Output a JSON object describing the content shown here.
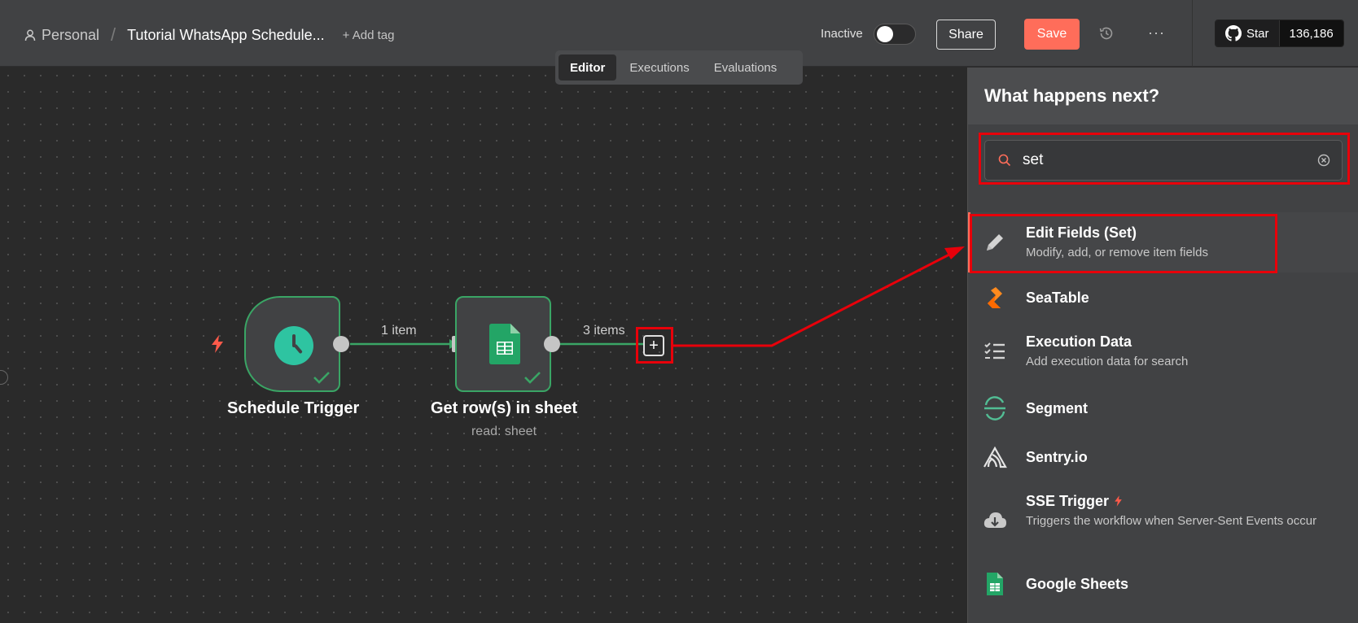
{
  "header": {
    "breadcrumb_project": "Personal",
    "workflow_title": "Tutorial WhatsApp Schedule...",
    "add_tag_label": "+ Add tag",
    "status_label": "Inactive",
    "share_label": "Share",
    "save_label": "Save",
    "more_label": "···",
    "github_star_label": "Star",
    "github_star_count": "136,186"
  },
  "tabs": [
    {
      "label": "Editor",
      "active": true
    },
    {
      "label": "Executions",
      "active": false
    },
    {
      "label": "Evaluations",
      "active": false
    }
  ],
  "canvas": {
    "nodes": [
      {
        "title": "Schedule Trigger",
        "subtitle": ""
      },
      {
        "title": "Get row(s) in sheet",
        "subtitle": "read: sheet"
      }
    ],
    "connections": [
      {
        "label": "1 item"
      },
      {
        "label": "3 items"
      }
    ]
  },
  "panel": {
    "title": "What happens next?",
    "search_value": "set",
    "items": [
      {
        "name": "Edit Fields (Set)",
        "description": "Modify, add, or remove item fields",
        "icon": "pencil-icon"
      },
      {
        "name": "SeaTable",
        "description": "",
        "icon": "seatable-icon"
      },
      {
        "name": "Execution Data",
        "description": "Add execution data for search",
        "icon": "checklist-icon"
      },
      {
        "name": "Segment",
        "description": "",
        "icon": "segment-icon"
      },
      {
        "name": "Sentry.io",
        "description": "",
        "icon": "sentry-icon"
      },
      {
        "name": "SSE Trigger",
        "description": "Triggers the workflow when Server-Sent Events occur",
        "icon": "cloud-download-icon"
      },
      {
        "name": "Google Sheets",
        "description": "",
        "icon": "google-sheets-icon"
      }
    ]
  },
  "colors": {
    "accent": "#ff6d5a",
    "node_border": "#3aa565",
    "annotation_red": "#e8000a",
    "trigger_teal": "#2ec4a1",
    "sheets_green": "#23a566"
  }
}
